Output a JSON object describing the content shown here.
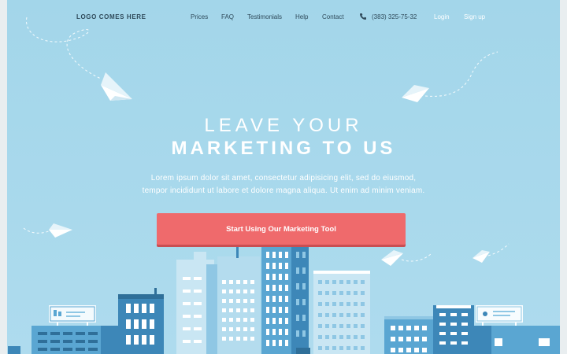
{
  "header": {
    "logo": "LOGO COMES HERE",
    "nav": [
      "Prices",
      "FAQ",
      "Testimonials",
      "Help",
      "Contact"
    ],
    "phone": "(383) 325-75-32",
    "phone_icon": "phone-icon",
    "login": "Login",
    "signup": "Sign up"
  },
  "hero": {
    "line1": "LEAVE YOUR",
    "line2": "MARKETING TO US",
    "description_line1": "Lorem ipsum dolor sit amet, consectetur adipisicing elit, sed do eiusmod,",
    "description_line2": "tempor incididunt ut labore et dolore magna aliqua. Ut enim ad minim veniam.",
    "cta_label": "Start Using Our Marketing Tool"
  },
  "colors": {
    "sky": "#a6d8ec",
    "cta": "#ef6a6c",
    "building_dark": "#3d87b8",
    "building_mid": "#5aa6d2",
    "building_light": "#8fc7e4",
    "building_pale": "#c9e6f3"
  }
}
